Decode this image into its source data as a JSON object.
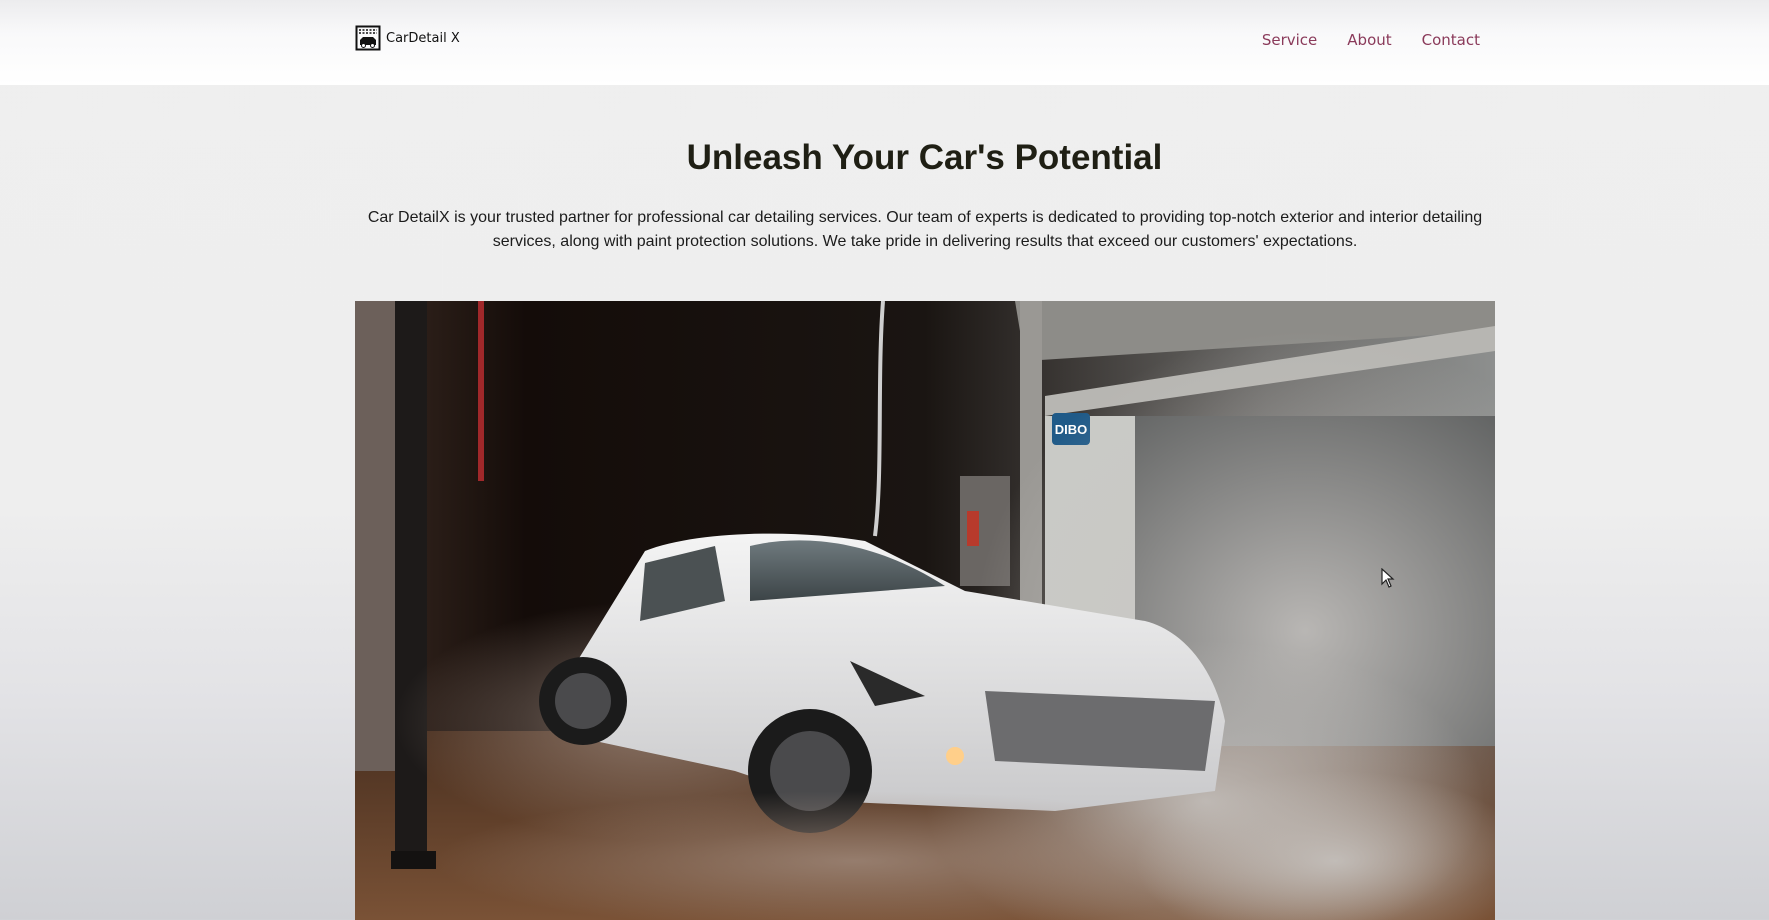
{
  "header": {
    "logo_text": "CarDetail X",
    "nav": [
      {
        "label": "Service"
      },
      {
        "label": "About"
      },
      {
        "label": "Contact"
      }
    ]
  },
  "hero": {
    "title": "Unleash Your Car's Potential",
    "description": "Car DetailX is your trusted partner for professional car detailing services. Our team of experts is dedicated to providing top-notch exterior and interior detailing services, along with paint protection solutions. We take pride in delivering results that exceed our customers' expectations.",
    "image_sign_text": "DIBO"
  },
  "colors": {
    "nav_link": "#8a3a5a",
    "title": "#1f1f14",
    "page_background": "#eeeeee"
  },
  "icons": {
    "logo": "car-wash-icon",
    "cursor": "mouse-pointer-icon"
  }
}
